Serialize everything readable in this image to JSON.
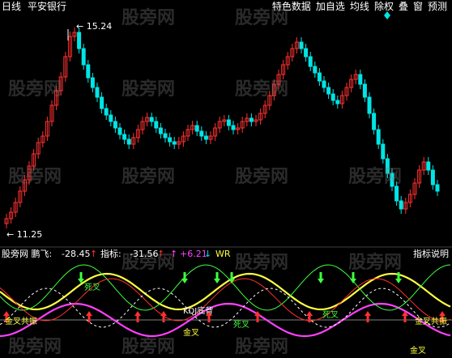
{
  "header": {
    "period": "日线",
    "stock": "平安银行",
    "menu": [
      "特色数据",
      "加自选",
      "均线",
      "除权",
      "叠",
      "窗",
      "预测"
    ]
  },
  "watermark": "股旁网",
  "price_chart": {
    "high_label": "15.24",
    "low_label": "11.25"
  },
  "indicator": {
    "name_label": "股旁网 鹏飞:",
    "value1": "-28.45",
    "label2": "指标:",
    "value2": "-31.56",
    "value3": "+6.21",
    "label4": "WR",
    "explain_button": "指标说明",
    "annotations": [
      "死叉",
      "KDJ底背",
      "死叉",
      "金叉共振",
      "金叉",
      "死叉",
      "金叉",
      "金叉共振"
    ],
    "colors": {
      "up": "#ff3030",
      "down": "#00e5e5",
      "yellow": "#ffff40",
      "magenta": "#ff40ff",
      "green": "#40ff40",
      "white": "#ffffff"
    }
  }
}
